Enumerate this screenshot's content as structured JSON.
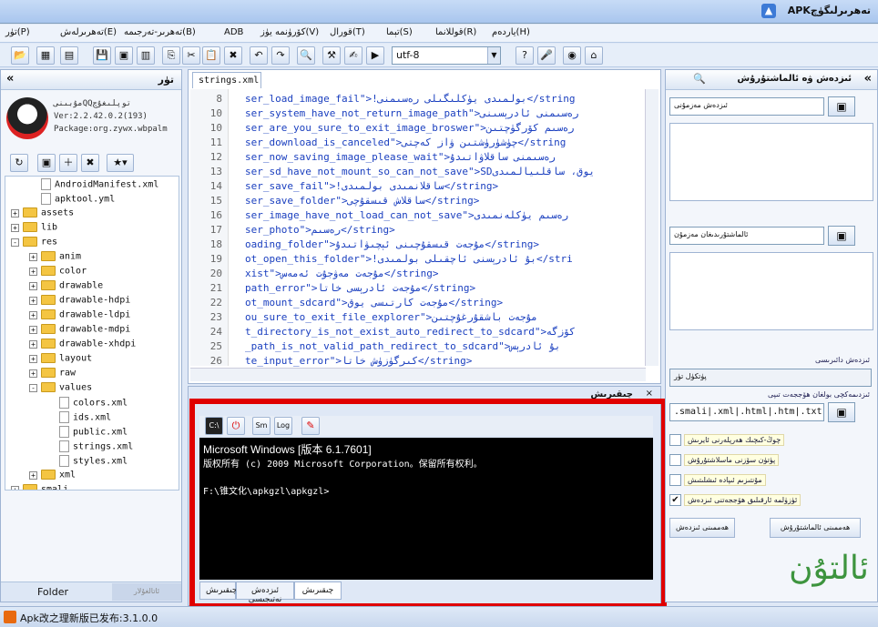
{
  "titlebar": {
    "title": "APKتەھرىرلىگۈچ"
  },
  "menu": [
    "تۈر(P)",
    "تەھرىرلەش(E)",
    "تەھرىر-تەرجىمە(B)",
    "ADB",
    "كۆرۈنمە يۈز(V)",
    "قورال(T)",
    "تېما(S)",
    "قوللانما(R)",
    "ياردەم(H)"
  ],
  "toolbar": {
    "encoding": "utf-8"
  },
  "left": {
    "title": "تۈر",
    "collapse": "«",
    "app_name": "مۇبىنىQQتوپلىغۇچ",
    "version": "Ver:2.2.42.0.2(193)",
    "package": "Package:org.zywx.wbpalm",
    "tree": [
      {
        "label": "AndroidManifest.xml",
        "kind": "file",
        "level": 1
      },
      {
        "label": "apktool.yml",
        "kind": "file",
        "level": 1
      },
      {
        "label": "assets",
        "kind": "folder",
        "level": 0,
        "exp": "+"
      },
      {
        "label": "lib",
        "kind": "folder",
        "level": 0,
        "exp": "+"
      },
      {
        "label": "res",
        "kind": "folder",
        "level": 0,
        "exp": "-"
      },
      {
        "label": "anim",
        "kind": "folder",
        "level": 1,
        "exp": "+"
      },
      {
        "label": "color",
        "kind": "folder",
        "level": 1,
        "exp": "+"
      },
      {
        "label": "drawable",
        "kind": "folder",
        "level": 1,
        "exp": "+"
      },
      {
        "label": "drawable-hdpi",
        "kind": "folder",
        "level": 1,
        "exp": "+"
      },
      {
        "label": "drawable-ldpi",
        "kind": "folder",
        "level": 1,
        "exp": "+"
      },
      {
        "label": "drawable-mdpi",
        "kind": "folder",
        "level": 1,
        "exp": "+"
      },
      {
        "label": "drawable-xhdpi",
        "kind": "folder",
        "level": 1,
        "exp": "+"
      },
      {
        "label": "layout",
        "kind": "folder",
        "level": 1,
        "exp": "+"
      },
      {
        "label": "raw",
        "kind": "folder",
        "level": 1,
        "exp": "+"
      },
      {
        "label": "values",
        "kind": "folder",
        "level": 1,
        "exp": "-"
      },
      {
        "label": "colors.xml",
        "kind": "file",
        "level": 2
      },
      {
        "label": "ids.xml",
        "kind": "file",
        "level": 2
      },
      {
        "label": "public.xml",
        "kind": "file",
        "level": 2
      },
      {
        "label": "strings.xml",
        "kind": "file",
        "level": 2
      },
      {
        "label": "styles.xml",
        "kind": "file",
        "level": 2
      },
      {
        "label": "xml",
        "kind": "folder",
        "level": 1,
        "exp": "+"
      },
      {
        "label": "smali",
        "kind": "folder",
        "level": 0,
        "exp": "+"
      }
    ],
    "bottom_tabs": [
      "Folder",
      "ئاتالغۇلار"
    ]
  },
  "editor": {
    "tab": "strings.xml",
    "lines": [
      {
        "n": "8",
        "t": "ser_load_image_fail\">!بولمىدى يۈكلىگىلى رەسىمنى</string"
      },
      {
        "n": "10",
        "t": "ser_system_have_not_return_image_path\">رەسىمنى ئادرېسىنى"
      },
      {
        "n": "10",
        "t": "ser_are_you_sure_to_exit_image_broswer\">رەسىم كۆرگۈچتىن"
      },
      {
        "n": "11",
        "t": "ser_download_is_canceled\">چۈشۈرۈشتىن ۋاز كەچتى</string"
      },
      {
        "n": "12",
        "t": "ser_now_saving_image_please_wait\">رەسىمنى ساقلاۋاتىدۇ"
      },
      {
        "n": "13",
        "t": "ser_sd_have_not_mount_so_can_not_save\">SDيوق، ساقلىيالمىدى"
      },
      {
        "n": "14",
        "t": "ser_save_fail\">!ساقلانمىدى بولمىدى</string>"
      },
      {
        "n": "15",
        "t": "ser_save_folder\">ساقلاش قىسقۇچى</string>"
      },
      {
        "n": "16",
        "t": "ser_image_have_not_load_can_not_save\">رەسىم يۈكلەنمىدى"
      },
      {
        "n": "17",
        "t": "ser_photo\">رەسىم</string>"
      },
      {
        "n": "18",
        "t": "oading_folder\">مۇجەت قىسقۇچىنى ئېچىۋاتىدۇ</string>"
      },
      {
        "n": "19",
        "t": "ot_open_this_folder\">!بۇ ئادرېسنى ئاچقىلى بولمىدى</stri"
      },
      {
        "n": "20",
        "t": "xist\">مۇجەت مەۋجۇت ئەمەس</string>"
      },
      {
        "n": "21",
        "t": "path_error\">مۇجەت ئادرېسى خاتا</string>"
      },
      {
        "n": "22",
        "t": "ot_mount_sdcard\">مۇجەت كارتىسى يوق</string>"
      },
      {
        "n": "23",
        "t": "ou_sure_to_exit_file_explorer\">مۇجەت باشقۇرغۇچتىن"
      },
      {
        "n": "24",
        "t": "t_directory_is_not_exist_auto_redirect_to_sdcard\">كۆزگە"
      },
      {
        "n": "25",
        "t": "_path_is_not_valid_path_redirect_to_sdcard\">بۇ ئادرېس"
      },
      {
        "n": "26",
        "t": "te_input_error\">كىرگۈزۈش خاتا</string>"
      }
    ]
  },
  "output": {
    "title": "چىقىرىش",
    "console": [
      "Microsoft Windows [版本 6.1.7601]",
      "版权所有 (c) 2009 Microsoft Corporation。保留所有权利。",
      "",
      "F:\\锥文化\\apkgzl\\apkgzl>"
    ],
    "tabs": [
      "چىقىرىش",
      "ئىزدەش نەتىجىسى",
      "چىقىرىش"
    ]
  },
  "right": {
    "title": "ئىزدەش ۋە ئالماشتۇرۇش",
    "find_label": "ئىزدەش مەزمۇنى",
    "replace_label": "ئالماشتۇرىدىغان مەزمۇن",
    "scope_label": "ئىزدەش دائىرىسى",
    "scope_value": "پۈتكۈل تۈر",
    "types_label": "ئىزدىمەكچى بولغان ھۆججەت تىپى",
    "types_value": ".smali|.xml|.html|.htm|.txt",
    "options": [
      {
        "label": "چوڭ-كىچىك ھەرپلەرنى ئايرىش",
        "checked": false
      },
      {
        "label": "پۈتۈن سۆزنى ماسلاشتۇرۇش",
        "checked": false
      },
      {
        "label": "مۇنتىزىم ئىپادە ئىشلىتىش",
        "checked": false
      },
      {
        "label": "ئۈزۈلمە ئارقىلىق ھۆججەتنى ئىزدەش",
        "checked": true
      }
    ],
    "replace_all": "ھەممىنى ئالماشتۇرۇش",
    "find_all": "ھەممىنى ئىزدەش"
  },
  "status": {
    "text": "Apk改之理新版已发布:3.1.0.0"
  },
  "watermark": "ئالتۇن"
}
